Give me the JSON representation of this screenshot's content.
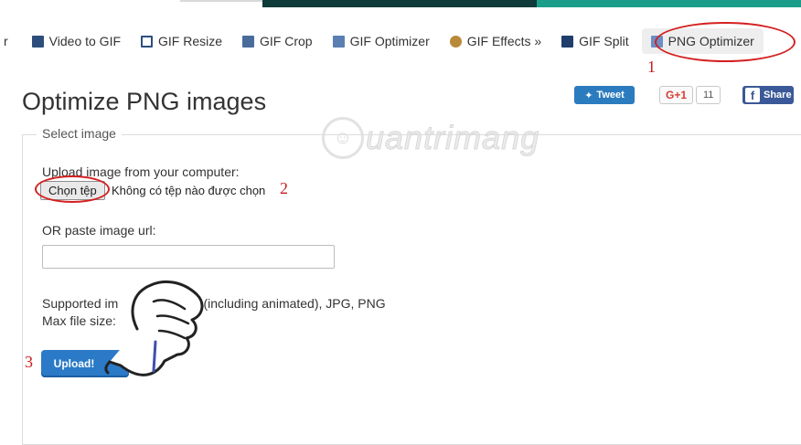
{
  "nav": {
    "items": [
      {
        "label": "r",
        "icon": "none"
      },
      {
        "label": "Video to GIF",
        "icon": "film-icon"
      },
      {
        "label": "GIF Resize",
        "icon": "resize-icon"
      },
      {
        "label": "GIF Crop",
        "icon": "crop-icon"
      },
      {
        "label": "GIF Optimizer",
        "icon": "optimizer-icon"
      },
      {
        "label": "GIF Effects »",
        "icon": "effects-icon"
      },
      {
        "label": "GIF Split",
        "icon": "split-icon"
      },
      {
        "label": "PNG Optimizer",
        "icon": "png-icon"
      }
    ]
  },
  "page": {
    "title": "Optimize PNG images"
  },
  "share": {
    "tweet": "Tweet",
    "gplus": "G+1",
    "gplus_count": "11",
    "facebook": "Share"
  },
  "watermark": {
    "text": "uantrimang"
  },
  "form": {
    "legend": "Select image",
    "upload_label": "Upload image from your computer:",
    "choose_file": "Chọn tệp",
    "file_status": "Không có tệp nào được chọn",
    "url_label": "OR paste image url:",
    "url_value": "",
    "supported_text": "Supported im",
    "supported_tail": "F (including animated), JPG, PNG",
    "max_size_text": "Max file size:",
    "upload_button": "Upload!"
  },
  "annotations": {
    "step1": "1",
    "step2": "2",
    "step3": "3"
  },
  "colors": {
    "accent": "#2a7ac7",
    "annotation": "#d42020",
    "tweet": "#2b7bbf",
    "facebook": "#3b5998",
    "bar_dark": "#0f3b3a",
    "bar_teal": "#1a9e8a"
  }
}
